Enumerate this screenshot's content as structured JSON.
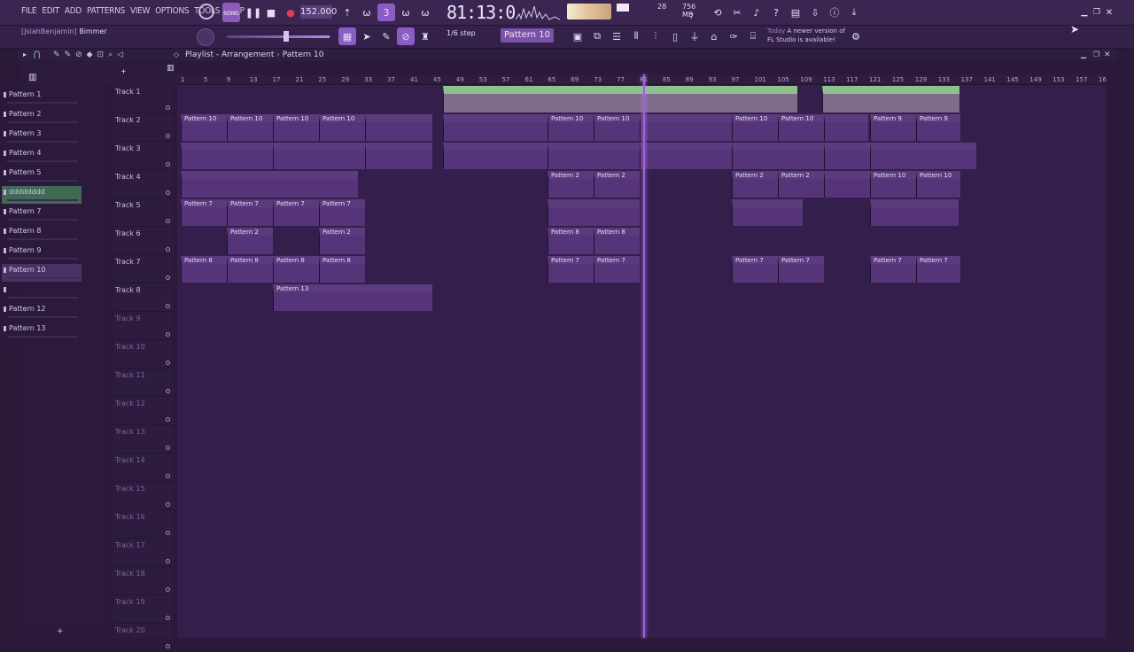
{
  "menu": [
    "FILE",
    "EDIT",
    "ADD",
    "PATTERNS",
    "VIEW",
    "OPTIONS",
    "TOOLS",
    "HELP"
  ],
  "transport": {
    "song_label": "SONG",
    "tempo": "152.000",
    "time": "81:13:06",
    "cpu": "28",
    "memory": "756 MB",
    "voices": "7"
  },
  "hint": {
    "user": "[JsiahBenjamin]",
    "name": "Bimmer"
  },
  "snap": "1/6 step",
  "pattern_selector": "Pattern 10",
  "news": {
    "day": "Today",
    "line1": "A newer version of",
    "line2": "FL Studio is available!"
  },
  "playlist": {
    "title": "Playlist - Arrangement",
    "pattern": "Pattern 10"
  },
  "patterns": [
    "Pattern 1",
    "Pattern 2",
    "Pattern 3",
    "Pattern 4",
    "Pattern 5",
    "dddddddd",
    "Pattern 7",
    "Pattern 8",
    "Pattern 9",
    "Pattern 10",
    "",
    "Pattern 12",
    "Pattern 13"
  ],
  "tracks": [
    "Track 1",
    "Track 2",
    "Track 3",
    "Track 4",
    "Track 5",
    "Track 6",
    "Track 7",
    "Track 8",
    "Track 9",
    "Track 10",
    "Track 11",
    "Track 12",
    "Track 13",
    "Track 14",
    "Track 15",
    "Track 16",
    "Track 17",
    "Track 18",
    "Track 19",
    "Track 20"
  ],
  "ruler": [
    "1",
    "5",
    "9",
    "13",
    "17",
    "21",
    "25",
    "29",
    "33",
    "37",
    "41",
    "45",
    "49",
    "53",
    "57",
    "61",
    "65",
    "69",
    "73",
    "77",
    "81",
    "85",
    "89",
    "93",
    "97",
    "101",
    "105",
    "109",
    "113",
    "117",
    "121",
    "125",
    "129",
    "133",
    "137",
    "141",
    "145",
    "149",
    "153",
    "157",
    "16"
  ],
  "clips": [
    {
      "label": "Pattern 10"
    },
    {
      "label": "Pattern 10"
    },
    {
      "label": "Pattern 10"
    },
    {
      "label": "Pattern 10"
    },
    {
      "label": "Pattern 10"
    },
    {
      "label": "Pattern 10"
    },
    {
      "label": "Pattern 10"
    },
    {
      "label": "Pattern 10"
    },
    {
      "label": "Pattern 9"
    },
    {
      "label": "Pattern 9"
    },
    {
      "label": "Pattern 2"
    },
    {
      "label": "Pattern 2"
    },
    {
      "label": "Pattern 2"
    },
    {
      "label": "Pattern 2"
    },
    {
      "label": "Pattern 10"
    },
    {
      "label": "Pattern 10"
    },
    {
      "label": "Pattern 7"
    },
    {
      "label": "Pattern 7"
    },
    {
      "label": "Pattern 7"
    },
    {
      "label": "Pattern 7"
    },
    {
      "label": "Pattern 2"
    },
    {
      "label": "Pattern 2"
    },
    {
      "label": "Pattern 8"
    },
    {
      "label": "Pattern 8"
    },
    {
      "label": "Pattern 8"
    },
    {
      "label": "Pattern 8"
    },
    {
      "label": "Pattern 8"
    },
    {
      "label": "Pattern 8"
    },
    {
      "label": "Pattern 7"
    },
    {
      "label": "Pattern 7"
    },
    {
      "label": "Pattern 7"
    },
    {
      "label": "Pattern 7"
    },
    {
      "label": "Pattern 7"
    },
    {
      "label": "Pattern 7"
    },
    {
      "label": "Pattern 13"
    }
  ],
  "colors": {
    "accent": "#8a5cc4",
    "playhead": "#a25de0",
    "grid": "#341f4c"
  }
}
